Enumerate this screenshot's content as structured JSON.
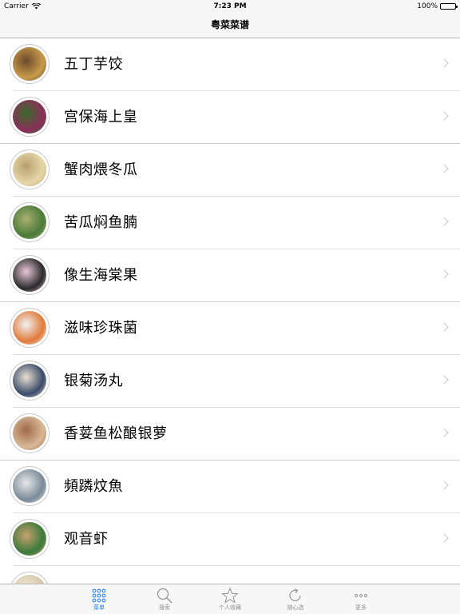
{
  "status_bar": {
    "carrier": "Carrier",
    "time": "7:23 PM",
    "battery": "100%",
    "battery_level": 1.0
  },
  "nav_bar": {
    "title": "粤菜菜谱"
  },
  "recipes": [
    {
      "name": "五丁芋饺",
      "thumb_color": "#c89a4a",
      "thumb_color2": "#6b4a2a"
    },
    {
      "name": "宫保海上皇",
      "thumb_color": "#8a2f5a",
      "thumb_color2": "#3a6b2a"
    },
    {
      "name": "蟹肉煨冬瓜",
      "thumb_color": "#e6d6a8",
      "thumb_color2": "#b8a070"
    },
    {
      "name": "苦瓜焖鱼腩",
      "thumb_color": "#4a7a3a",
      "thumb_color2": "#a8b070"
    },
    {
      "name": "像生海棠果",
      "thumb_color": "#2a2a2a",
      "thumb_color2": "#e8c8d8"
    },
    {
      "name": "滋味珍珠菌",
      "thumb_color": "#e07a3a",
      "thumb_color2": "#f2f2f2"
    },
    {
      "name": "银菊汤丸",
      "thumb_color": "#3a4a6a",
      "thumb_color2": "#e8e0d0"
    },
    {
      "name": "香荽鱼松酿银萝",
      "thumb_color": "#d8b898",
      "thumb_color2": "#a06a4a"
    },
    {
      "name": "頻蹸炆魚",
      "thumb_color": "#7a8a9a",
      "thumb_color2": "#e8e8e8"
    },
    {
      "name": "观音虾",
      "thumb_color": "#3a7a3a",
      "thumb_color2": "#c8a070"
    },
    {
      "name": "",
      "thumb_color": "#d8c8a8",
      "thumb_color2": "#f0e8d8"
    }
  ],
  "tab_bar": {
    "tabs": [
      {
        "label": "菜单",
        "icon": "grid-icon",
        "active": true
      },
      {
        "label": "搜索",
        "icon": "search-icon",
        "active": false
      },
      {
        "label": "个人收藏",
        "icon": "star-icon",
        "active": false
      },
      {
        "label": "随心选",
        "icon": "refresh-icon",
        "active": false
      },
      {
        "label": "更多",
        "icon": "more-icon",
        "active": false
      }
    ]
  },
  "colors": {
    "accent": "#1d7cf2",
    "inactive": "#929292",
    "separator": "#e1e1e1",
    "chevron": "#c7c7cc"
  }
}
